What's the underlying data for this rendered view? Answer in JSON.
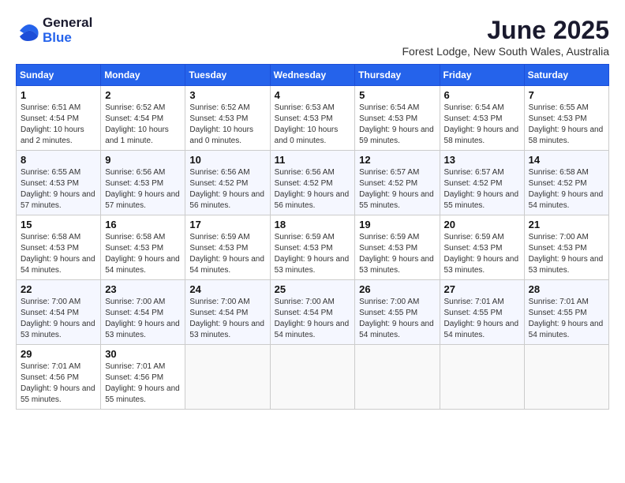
{
  "logo": {
    "general": "General",
    "blue": "Blue"
  },
  "title": {
    "month_year": "June 2025",
    "location": "Forest Lodge, New South Wales, Australia"
  },
  "weekdays": [
    "Sunday",
    "Monday",
    "Tuesday",
    "Wednesday",
    "Thursday",
    "Friday",
    "Saturday"
  ],
  "weeks": [
    [
      {
        "day": "1",
        "sunrise": "6:51 AM",
        "sunset": "4:54 PM",
        "daylight": "10 hours and 2 minutes."
      },
      {
        "day": "2",
        "sunrise": "6:52 AM",
        "sunset": "4:54 PM",
        "daylight": "10 hours and 1 minute."
      },
      {
        "day": "3",
        "sunrise": "6:52 AM",
        "sunset": "4:53 PM",
        "daylight": "10 hours and 0 minutes."
      },
      {
        "day": "4",
        "sunrise": "6:53 AM",
        "sunset": "4:53 PM",
        "daylight": "10 hours and 0 minutes."
      },
      {
        "day": "5",
        "sunrise": "6:54 AM",
        "sunset": "4:53 PM",
        "daylight": "9 hours and 59 minutes."
      },
      {
        "day": "6",
        "sunrise": "6:54 AM",
        "sunset": "4:53 PM",
        "daylight": "9 hours and 58 minutes."
      },
      {
        "day": "7",
        "sunrise": "6:55 AM",
        "sunset": "4:53 PM",
        "daylight": "9 hours and 58 minutes."
      }
    ],
    [
      {
        "day": "8",
        "sunrise": "6:55 AM",
        "sunset": "4:53 PM",
        "daylight": "9 hours and 57 minutes."
      },
      {
        "day": "9",
        "sunrise": "6:56 AM",
        "sunset": "4:53 PM",
        "daylight": "9 hours and 57 minutes."
      },
      {
        "day": "10",
        "sunrise": "6:56 AM",
        "sunset": "4:52 PM",
        "daylight": "9 hours and 56 minutes."
      },
      {
        "day": "11",
        "sunrise": "6:56 AM",
        "sunset": "4:52 PM",
        "daylight": "9 hours and 56 minutes."
      },
      {
        "day": "12",
        "sunrise": "6:57 AM",
        "sunset": "4:52 PM",
        "daylight": "9 hours and 55 minutes."
      },
      {
        "day": "13",
        "sunrise": "6:57 AM",
        "sunset": "4:52 PM",
        "daylight": "9 hours and 55 minutes."
      },
      {
        "day": "14",
        "sunrise": "6:58 AM",
        "sunset": "4:52 PM",
        "daylight": "9 hours and 54 minutes."
      }
    ],
    [
      {
        "day": "15",
        "sunrise": "6:58 AM",
        "sunset": "4:53 PM",
        "daylight": "9 hours and 54 minutes."
      },
      {
        "day": "16",
        "sunrise": "6:58 AM",
        "sunset": "4:53 PM",
        "daylight": "9 hours and 54 minutes."
      },
      {
        "day": "17",
        "sunrise": "6:59 AM",
        "sunset": "4:53 PM",
        "daylight": "9 hours and 54 minutes."
      },
      {
        "day": "18",
        "sunrise": "6:59 AM",
        "sunset": "4:53 PM",
        "daylight": "9 hours and 53 minutes."
      },
      {
        "day": "19",
        "sunrise": "6:59 AM",
        "sunset": "4:53 PM",
        "daylight": "9 hours and 53 minutes."
      },
      {
        "day": "20",
        "sunrise": "6:59 AM",
        "sunset": "4:53 PM",
        "daylight": "9 hours and 53 minutes."
      },
      {
        "day": "21",
        "sunrise": "7:00 AM",
        "sunset": "4:53 PM",
        "daylight": "9 hours and 53 minutes."
      }
    ],
    [
      {
        "day": "22",
        "sunrise": "7:00 AM",
        "sunset": "4:54 PM",
        "daylight": "9 hours and 53 minutes."
      },
      {
        "day": "23",
        "sunrise": "7:00 AM",
        "sunset": "4:54 PM",
        "daylight": "9 hours and 53 minutes."
      },
      {
        "day": "24",
        "sunrise": "7:00 AM",
        "sunset": "4:54 PM",
        "daylight": "9 hours and 53 minutes."
      },
      {
        "day": "25",
        "sunrise": "7:00 AM",
        "sunset": "4:54 PM",
        "daylight": "9 hours and 54 minutes."
      },
      {
        "day": "26",
        "sunrise": "7:00 AM",
        "sunset": "4:55 PM",
        "daylight": "9 hours and 54 minutes."
      },
      {
        "day": "27",
        "sunrise": "7:01 AM",
        "sunset": "4:55 PM",
        "daylight": "9 hours and 54 minutes."
      },
      {
        "day": "28",
        "sunrise": "7:01 AM",
        "sunset": "4:55 PM",
        "daylight": "9 hours and 54 minutes."
      }
    ],
    [
      {
        "day": "29",
        "sunrise": "7:01 AM",
        "sunset": "4:56 PM",
        "daylight": "9 hours and 55 minutes."
      },
      {
        "day": "30",
        "sunrise": "7:01 AM",
        "sunset": "4:56 PM",
        "daylight": "9 hours and 55 minutes."
      },
      null,
      null,
      null,
      null,
      null
    ]
  ]
}
